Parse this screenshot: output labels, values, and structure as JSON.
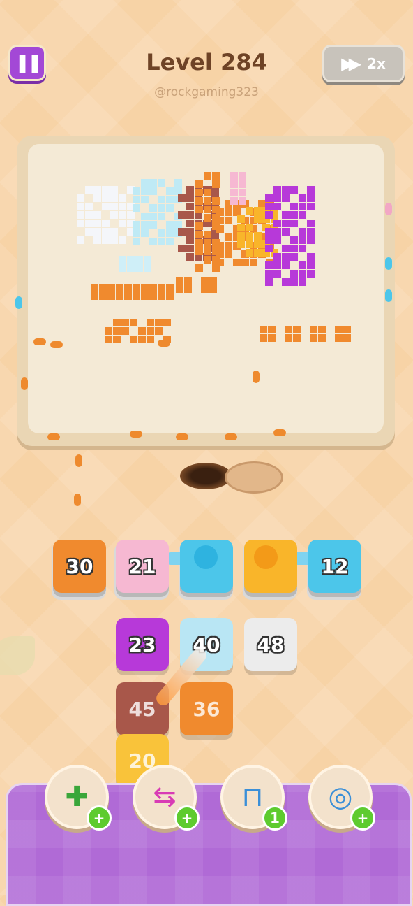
{
  "header": {
    "pause_icon": "pause-icon",
    "title": "Level 284",
    "username": "@rockgaming323",
    "speed_label": "2x",
    "speed_icon": "fast-forward-icon"
  },
  "tray": [
    {
      "value": "30",
      "color": "#f08a2e"
    },
    {
      "value": "21",
      "color": "#f6b8d2"
    },
    {
      "value": "",
      "color": "#4cc6ea"
    },
    {
      "value": "",
      "color": "#f9b52a"
    },
    {
      "value": "12",
      "color": "#4cc6ea"
    }
  ],
  "grid": [
    {
      "value": "23",
      "color": "#b739d9"
    },
    {
      "value": "40",
      "color": "#b9e6f4"
    },
    {
      "value": "48",
      "color": "#ececec"
    },
    {
      "value": "45",
      "color": "#a8574a"
    },
    {
      "value": "36",
      "color": "#f08a2e"
    },
    {
      "value": "20",
      "color": "#f9c33a"
    }
  ],
  "boosters": [
    {
      "name": "add-slot-booster",
      "icon": "add-tray-icon",
      "badge": "+"
    },
    {
      "name": "shuffle-booster",
      "icon": "shuffle-icon",
      "badge": "+"
    },
    {
      "name": "magnet-booster",
      "icon": "magnet-icon",
      "badge": "1"
    },
    {
      "name": "donut-booster",
      "icon": "donut-icon",
      "badge": "+"
    }
  ],
  "colors": {
    "accent_purple": "#a348d6",
    "panel_purple": "#b06ad6",
    "title_brown": "#6e4326",
    "orange": "#f08a2e",
    "cyan": "#4cc6ea"
  }
}
